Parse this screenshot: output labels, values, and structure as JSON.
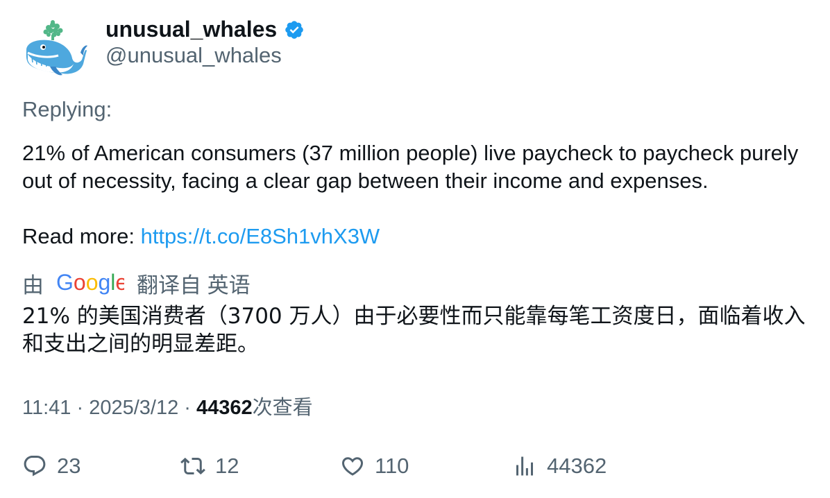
{
  "user": {
    "display_name": "unusual_whales",
    "handle": "@unusual_whales",
    "verified_icon": "verified-badge-icon",
    "avatar_icon": "whale-avatar"
  },
  "tweet": {
    "replying_label": "Replying:",
    "text_line1": "21% of American consumers (37 million people) live paycheck to paycheck purely out of necessity, facing a clear gap between their income and expenses.",
    "read_more_label": "Read more: ",
    "link": "https://t.co/E8Sh1vhX3W"
  },
  "translation": {
    "prefix": "由",
    "provider": "Google",
    "suffix": "翻译自 英语",
    "text": "21% 的美国消费者（3700 万人）由于必要性而只能靠每笔工资度日，面临着收入和支出之间的明显差距。"
  },
  "meta": {
    "time": "11:41",
    "separator": " · ",
    "date": "2025/3/12",
    "views_count": "44362",
    "views_label": "次查看"
  },
  "actions": {
    "replies": "23",
    "retweets": "12",
    "likes": "110",
    "views": "44362"
  },
  "colors": {
    "link": "#1d9bf0",
    "secondary_text": "#536471",
    "primary_text": "#0f1419"
  }
}
